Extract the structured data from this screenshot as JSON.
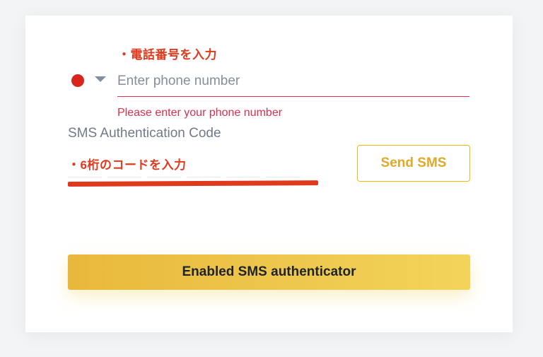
{
  "annotations": {
    "phone": "・電話番号を入力",
    "code": "・6桁のコードを入力"
  },
  "phone": {
    "placeholder": "Enter phone number",
    "value": "",
    "error": "Please enter your phone number",
    "flag_color": "#d9261c"
  },
  "sms": {
    "label": "SMS Authentication Code",
    "digits": [
      "",
      "",
      "",
      "",
      "",
      ""
    ],
    "send_label": "Send SMS"
  },
  "submit_label": "Enabled SMS authenticator",
  "colors": {
    "annotation": "#e03a1e",
    "error": "#d9304e",
    "accent": "#f0b90b",
    "button_gradient_start": "#e8b83c",
    "button_gradient_end": "#f3d45a"
  }
}
